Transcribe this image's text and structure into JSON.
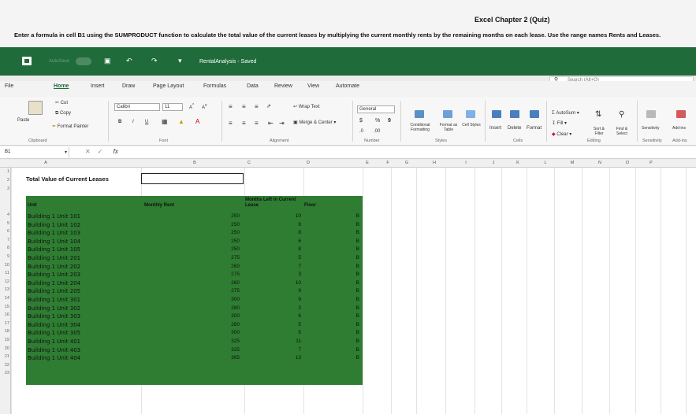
{
  "quiz_title": "Excel Chapter 2 (Quiz)",
  "instructions": "Enter a formula in cell B1 using the SUMPRODUCT function to calculate the total value of the current leases by multiplying the current monthly rents by the remaining months on each lease. Use the range names Rents and Leases.",
  "titlebar": {
    "autosave": "AutoSave",
    "document_title": "RentalAnalysis - Saved",
    "search_placeholder": "Search (Alt+Q)"
  },
  "tabs": [
    "File",
    "Home",
    "Insert",
    "Draw",
    "Page Layout",
    "Formulas",
    "Data",
    "Review",
    "View",
    "Automate"
  ],
  "active_tab": "Home",
  "ribbon": {
    "cut": "Cut",
    "copy": "Copy",
    "paste": "Paste",
    "format_painter": "Format Painter",
    "clipboard_group": "Clipboard",
    "font_name": "Calibri",
    "font_size": "11",
    "font_group": "Font",
    "bold": "B",
    "italic": "I",
    "underline": "U",
    "wrap_text": "Wrap Text",
    "merge_center": "Merge & Center",
    "alignment_group": "Alignment",
    "number_format": "General",
    "currency": "$",
    "percent": "%",
    "comma": "9",
    "number_group": "Number",
    "conditional_formatting": "Conditional Formatting",
    "format_as_table": "Format as Table",
    "cell_styles": "Cell Styles",
    "styles_group": "Styles",
    "insert": "Insert",
    "delete": "Delete",
    "format": "Format",
    "cells_group": "Cells",
    "autosum": "AutoSum",
    "fill": "Fill",
    "clear": "Clear",
    "sort_filter": "Sort & Filter",
    "find_select": "Find & Select",
    "editing_group": "Editing",
    "sensitivity": "Sensitivity",
    "sensitivity_group": "Sensitivity",
    "addins": "Add-ins",
    "addins_group": "Add-ins"
  },
  "formula_bar": {
    "name_box": "B1",
    "fx": "fx",
    "cancel": "✕",
    "enter": "✓",
    "formula": ""
  },
  "columns": [
    "A",
    "B",
    "C",
    "D",
    "E",
    "F",
    "G",
    "H",
    "I",
    "J",
    "K",
    "L",
    "M",
    "N",
    "O",
    "P"
  ],
  "rows": [
    "1",
    "2",
    "3",
    "4",
    "5",
    "6",
    "7",
    "8",
    "9",
    "10",
    "11",
    "12",
    "13",
    "14",
    "15",
    "16",
    "17",
    "18",
    "19",
    "20",
    "21",
    "22",
    "23"
  ],
  "sheet": {
    "title": "Total Value of Current Leases",
    "headers": {
      "unit": "Unit",
      "rent": "Monthly Rent",
      "months": "Months Left in Current Lease",
      "floor": "Floor"
    },
    "data": [
      {
        "unit": "Building 1 Unit 101",
        "rent": "250",
        "months": "10",
        "floor": "B"
      },
      {
        "unit": "Building 1 Unit 102",
        "rent": "250",
        "months": "9",
        "floor": "B"
      },
      {
        "unit": "Building 1 Unit 103",
        "rent": "250",
        "months": "8",
        "floor": "B"
      },
      {
        "unit": "Building 1 Unit 104",
        "rent": "250",
        "months": "6",
        "floor": "B"
      },
      {
        "unit": "Building 1 Unit 105",
        "rent": "250",
        "months": "8",
        "floor": "B"
      },
      {
        "unit": "Building 1 Unit 201",
        "rent": "275",
        "months": "5",
        "floor": "B"
      },
      {
        "unit": "Building 1 Unit 202",
        "rent": "260",
        "months": "7",
        "floor": "B"
      },
      {
        "unit": "Building 1 Unit 203",
        "rent": "275",
        "months": "3",
        "floor": "B"
      },
      {
        "unit": "Building 1 Unit 204",
        "rent": "260",
        "months": "10",
        "floor": "B"
      },
      {
        "unit": "Building 1 Unit 205",
        "rent": "275",
        "months": "9",
        "floor": "B"
      },
      {
        "unit": "Building 1 Unit 301",
        "rent": "300",
        "months": "9",
        "floor": "B"
      },
      {
        "unit": "Building 1 Unit 302",
        "rent": "280",
        "months": "3",
        "floor": "B"
      },
      {
        "unit": "Building 1 Unit 303",
        "rent": "300",
        "months": "6",
        "floor": "B"
      },
      {
        "unit": "Building 1 Unit 304",
        "rent": "280",
        "months": "5",
        "floor": "B"
      },
      {
        "unit": "Building 1 Unit 305",
        "rent": "300",
        "months": "5",
        "floor": "B"
      },
      {
        "unit": "Building 1 Unit 401",
        "rent": "325",
        "months": "11",
        "floor": "B"
      },
      {
        "unit": "Building 1 Unit 403",
        "rent": "325",
        "months": "7",
        "floor": "B"
      },
      {
        "unit": "Building 1 Unit 404",
        "rent": "365",
        "months": "13",
        "floor": "B"
      }
    ]
  },
  "colors": {
    "excel_green": "#1f6b3a",
    "data_block": "#2e7d32"
  }
}
